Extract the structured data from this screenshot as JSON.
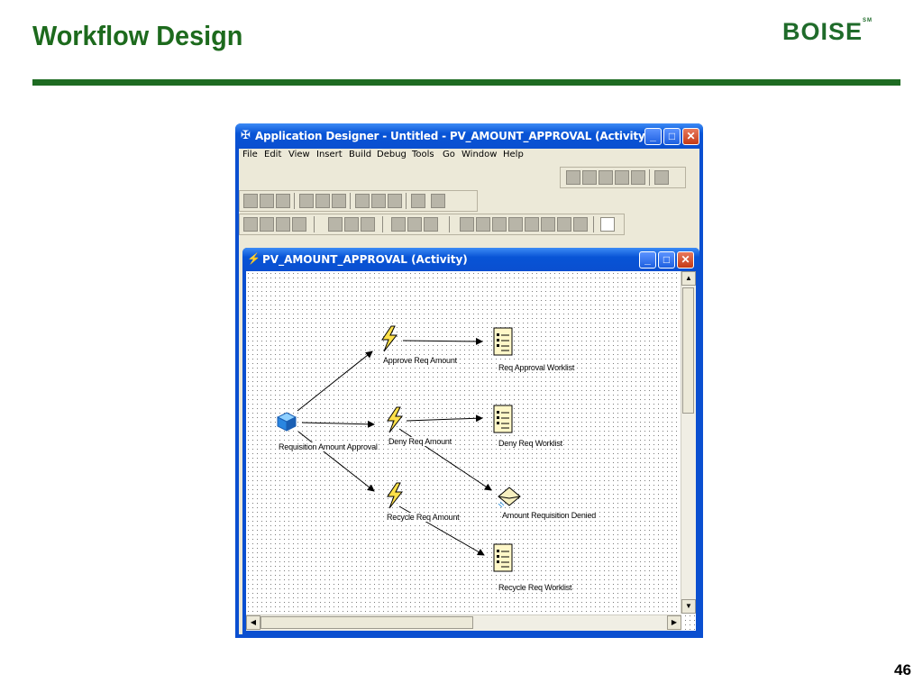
{
  "slide": {
    "title": "Workflow Design",
    "logo": "BOISE",
    "page_number": "46"
  },
  "app_window": {
    "title": "Application Designer - Untitled - PV_AMOUNT_APPROVAL (Activity)",
    "menu": [
      "File",
      "Edit",
      "View",
      "Insert",
      "Build",
      "Debug",
      "Tools",
      "Go",
      "Window",
      "Help"
    ]
  },
  "child_window": {
    "title": "PV_AMOUNT_APPROVAL (Activity)"
  },
  "workflow": {
    "nodes": {
      "requisition_amount_approval": "Requisition Amount Approval",
      "approve_req_amount": "Approve Req Amount",
      "deny_req_amount": "Deny Req Amount",
      "recycle_req_amount": "Recycle Req Amount",
      "req_approval_worklist": "Req Approval Worklist",
      "deny_req_worklist": "Deny Req Worklist",
      "amount_requisition_denied": "Amount Requisition Denied",
      "recycle_req_worklist": "Recycle Req Worklist"
    }
  },
  "colors": {
    "title_green": "#1d6a1d",
    "rule_green": "#1e6b22",
    "xp_blue": "#0a4fd0",
    "close_red": "#c43a16"
  }
}
